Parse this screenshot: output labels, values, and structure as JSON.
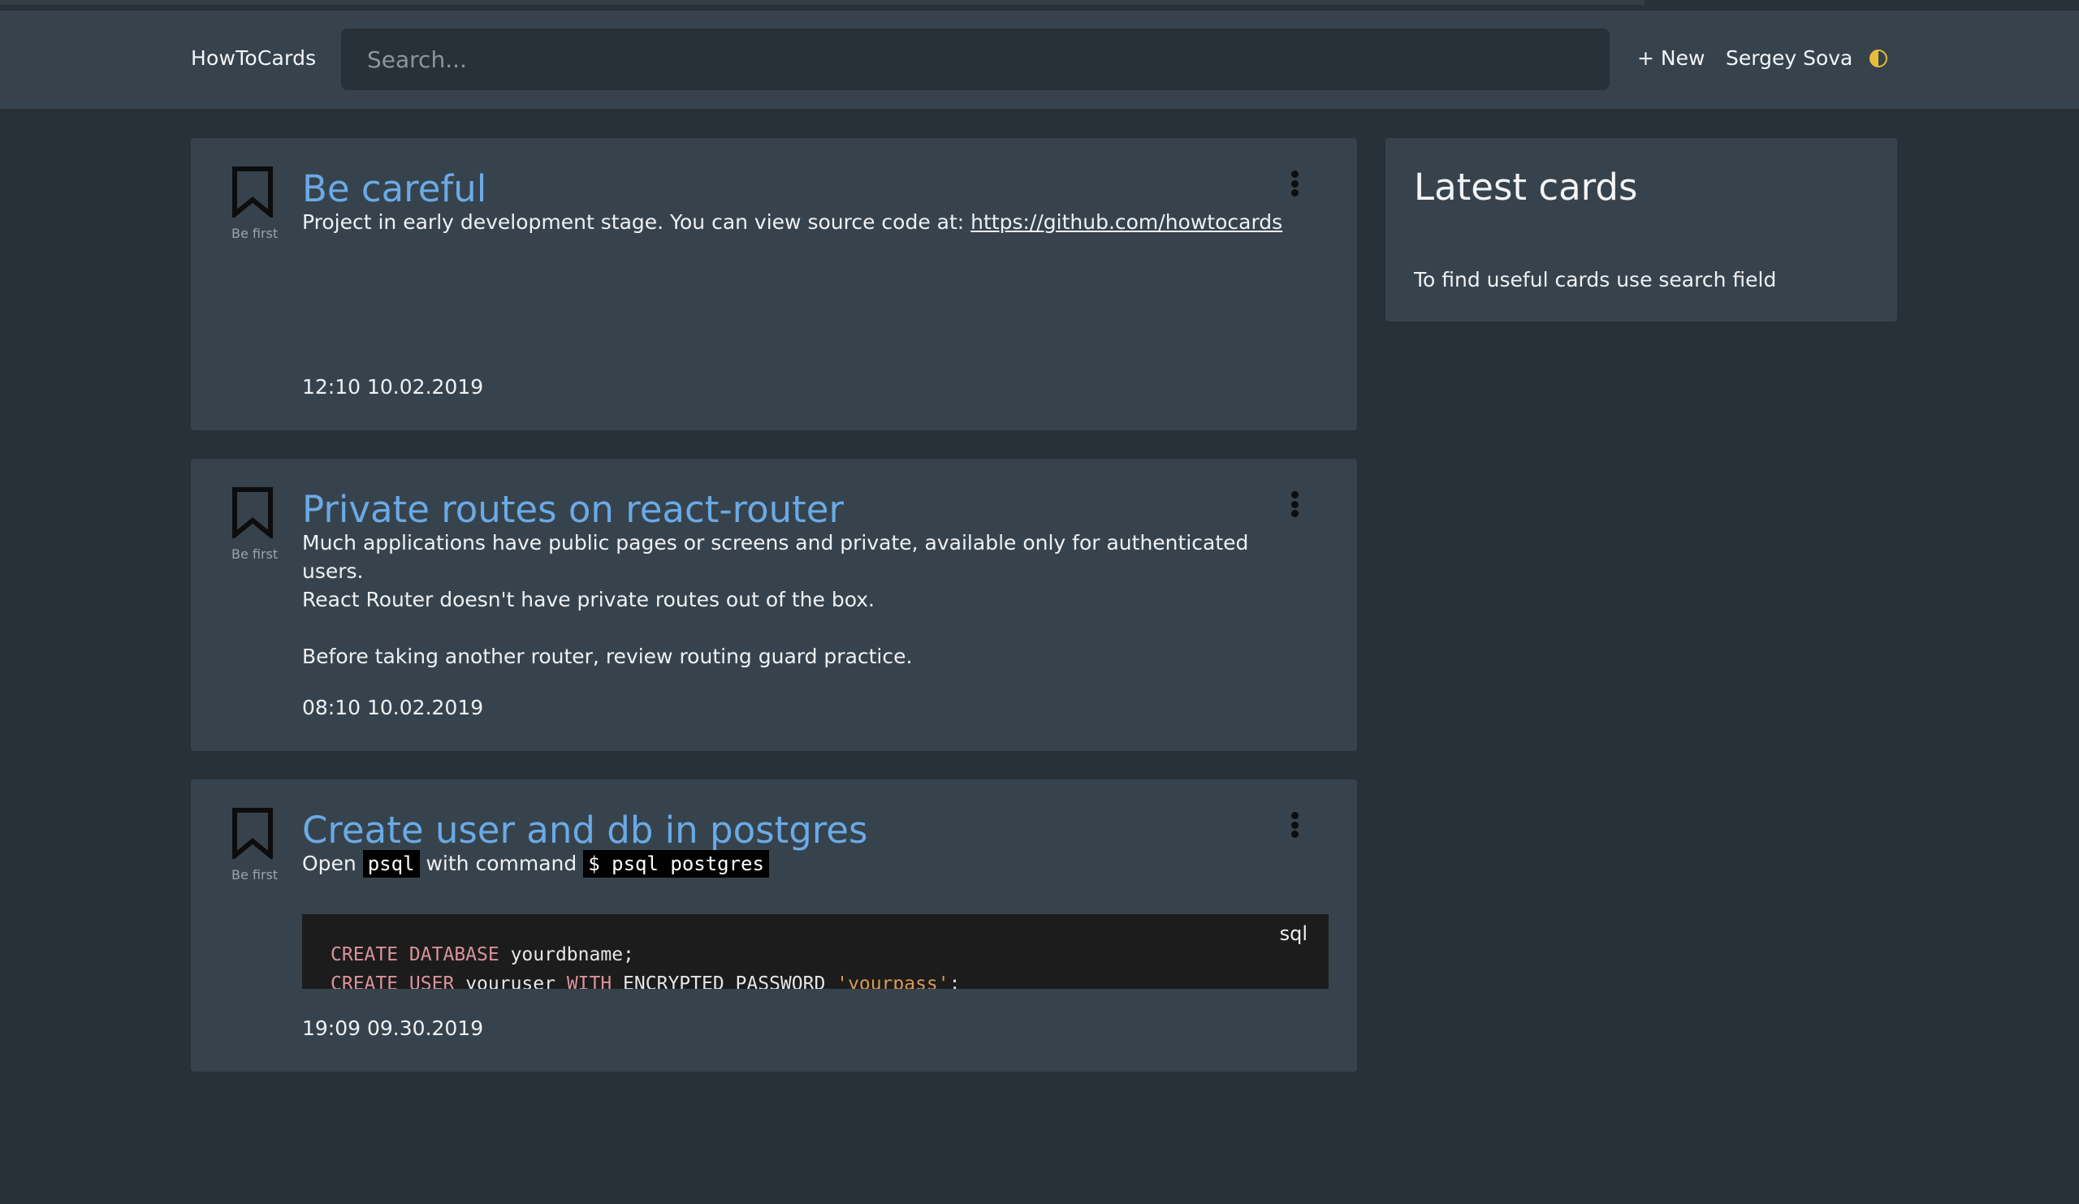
{
  "app": {
    "brand": "HowToCards"
  },
  "header": {
    "search_placeholder": "Search...",
    "new_label": "+ New",
    "user_name": "Sergey Sova",
    "theme_toggle_icon": "half-moon-icon"
  },
  "cards": [
    {
      "title": "Be careful",
      "bookmark_caption": "Be first",
      "body_text": "Project in early development stage. You can view source code at: ",
      "body_link": "https://github.com/howtocards",
      "date": "12:10 10.02.2019"
    },
    {
      "title": "Private routes on react-router",
      "bookmark_caption": "Be first",
      "body_line1": "Much applications have public pages or screens and private, available only for authenticated users.",
      "body_line2": "React Router doesn't have private routes out of the box.",
      "body_line3": "Before taking another router, review routing guard practice.",
      "date": "08:10 10.02.2019"
    },
    {
      "title": "Create user and db in postgres",
      "bookmark_caption": "Be first",
      "body_open": "Open",
      "body_code1": "psql",
      "body_with": "with command",
      "body_code2": "$ psql postgres",
      "code_lang": "sql",
      "code_line1": {
        "kw": "CREATE DATABASE",
        "rest": " yourdbname;"
      },
      "code_line2": {
        "kw1": "CREATE USER",
        "mid": " youruser ",
        "kw2": "WITH",
        "mid2": " ENCRYPTED PASSWORD ",
        "str": "'yourpass'",
        "end": ";"
      },
      "date": "19:09 09.30.2019"
    }
  ],
  "sidebar": {
    "title": "Latest cards",
    "hint": "To find useful cards use search field"
  },
  "colors": {
    "background": "#283038",
    "panel": "#37434c",
    "title_link": "#6aaae6",
    "theme_toggle": "#e9bd3a"
  }
}
